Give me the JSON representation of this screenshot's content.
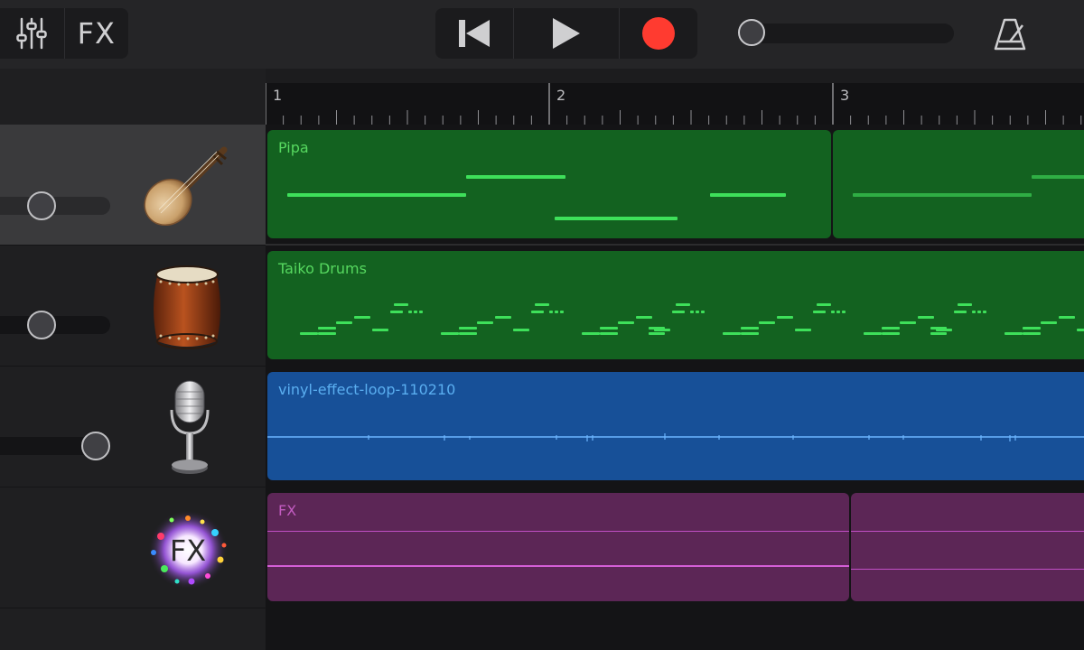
{
  "toolbar": {
    "mixer_icon": "mixer-sliders-icon",
    "fx_label": "FX",
    "transport": [
      "skip-back-icon",
      "play-icon",
      "record-icon"
    ],
    "record_color": "#ff3b30",
    "metronome_icon": "metronome-icon"
  },
  "ruler": {
    "bars": [
      "1",
      "2",
      "3"
    ]
  },
  "tracks": [
    {
      "instrument": "Pipa",
      "icon": "pipa-icon",
      "selected": true
    },
    {
      "instrument": "Taiko Drums",
      "icon": "taiko-drum-icon",
      "selected": false
    },
    {
      "instrument": "Audio Recorder",
      "icon": "microphone-icon",
      "selected": false
    },
    {
      "instrument": "FX",
      "icon": "fx-burst-icon",
      "icon_text": "FX",
      "selected": false
    }
  ],
  "regions": {
    "pipa": {
      "title": "Pipa",
      "color": "#136220"
    },
    "taiko": {
      "title": "Taiko Drums",
      "color": "#136220"
    },
    "vinyl": {
      "title": "vinyl-effect-loop-110210",
      "color": "#175098"
    },
    "fx": {
      "title": "FX",
      "color": "#5c2656"
    }
  }
}
